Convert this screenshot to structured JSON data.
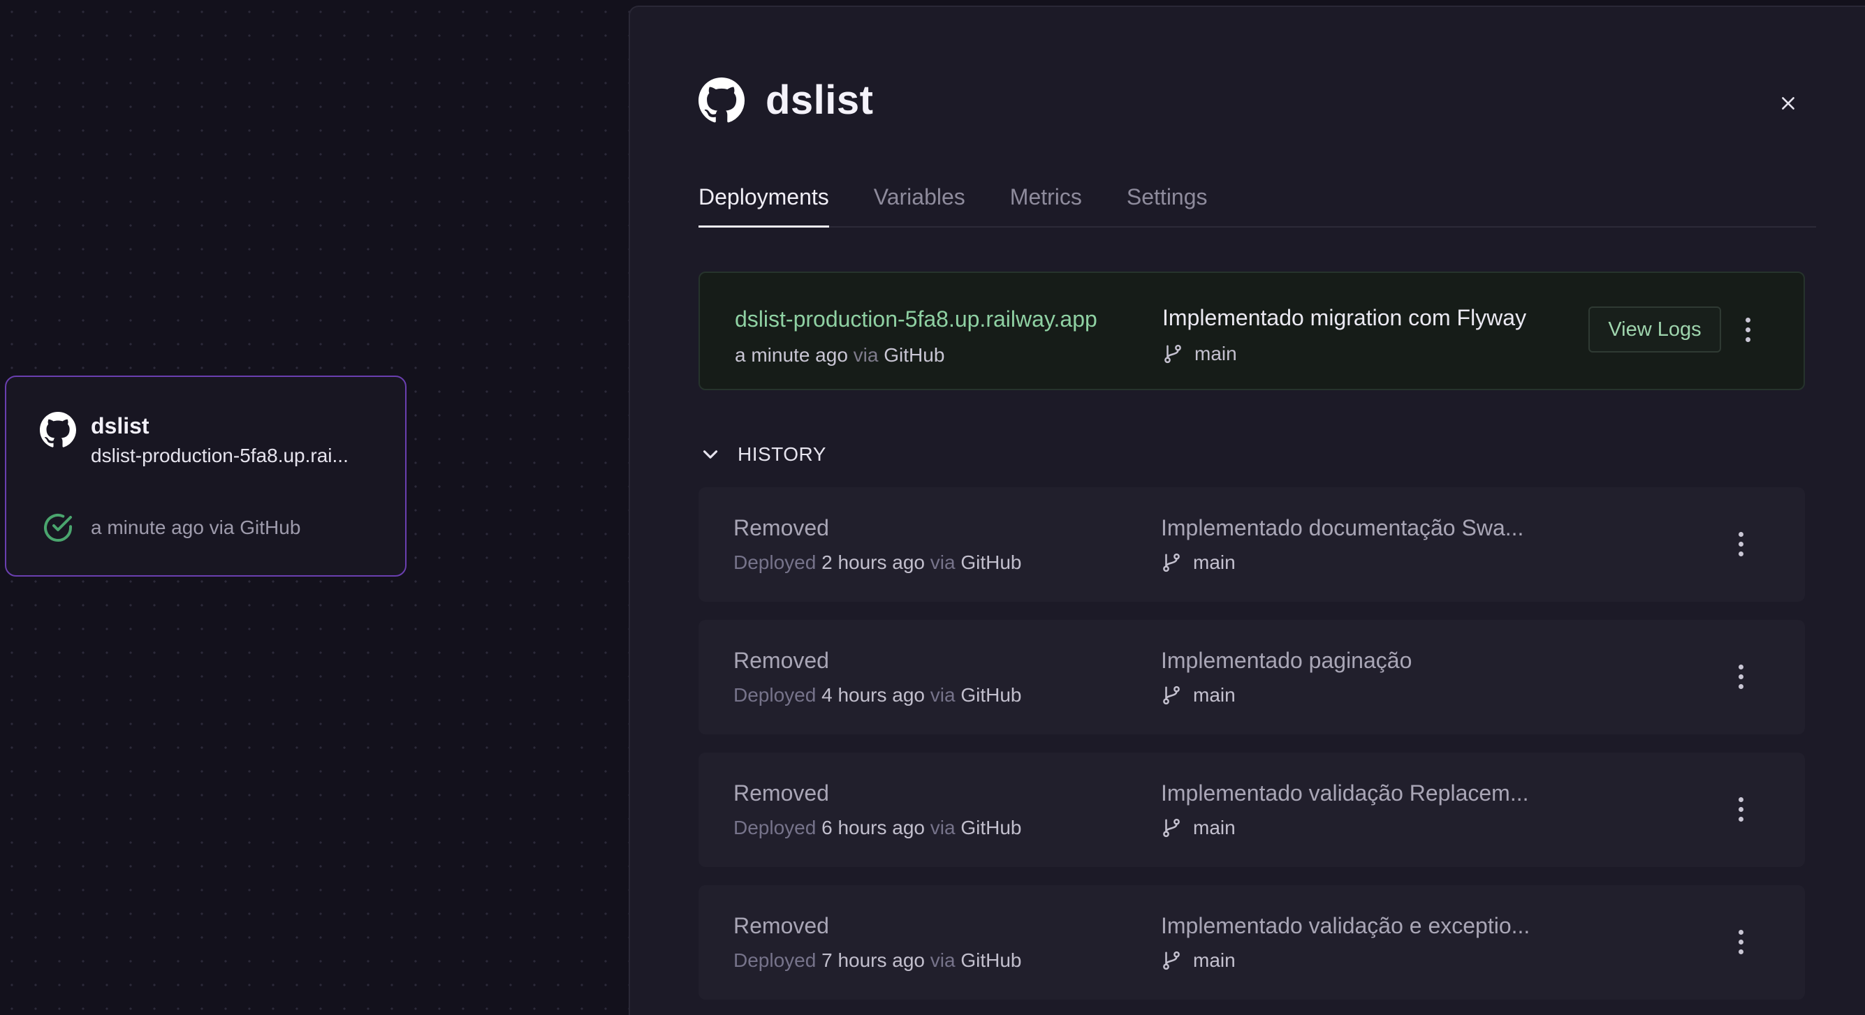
{
  "service_card": {
    "name": "dslist",
    "url": "dslist-production-5fa8.up.rai...",
    "status_text": "a minute ago via GitHub",
    "icon": "github-icon",
    "status_icon": "check-circle-icon",
    "border_color": "#6a3fb0",
    "check_color": "#4aa56e"
  },
  "panel": {
    "title": "dslist",
    "icon": "github-icon",
    "close_icon": "close-icon",
    "tabs": [
      {
        "label": "Deployments",
        "active": true
      },
      {
        "label": "Variables",
        "active": false
      },
      {
        "label": "Metrics",
        "active": false
      },
      {
        "label": "Settings",
        "active": false
      }
    ]
  },
  "active_deployment": {
    "domain": "dslist-production-5fa8.up.railway.app",
    "time": "a minute ago",
    "via": "via",
    "source": "GitHub",
    "commit_message": "Implementado migration com Flyway",
    "branch": "main",
    "view_logs_label": "View Logs",
    "accent_color": "#8fd1a3"
  },
  "history": {
    "label": "HISTORY",
    "items": [
      {
        "status": "Removed",
        "deployed_prefix": "Deployed",
        "time": "2 hours ago",
        "via": "via",
        "source": "GitHub",
        "commit_message": "Implementado documentação Swa...",
        "branch": "main"
      },
      {
        "status": "Removed",
        "deployed_prefix": "Deployed",
        "time": "4 hours ago",
        "via": "via",
        "source": "GitHub",
        "commit_message": "Implementado paginação",
        "branch": "main"
      },
      {
        "status": "Removed",
        "deployed_prefix": "Deployed",
        "time": "6 hours ago",
        "via": "via",
        "source": "GitHub",
        "commit_message": "Implementado validação Replacem...",
        "branch": "main"
      },
      {
        "status": "Removed",
        "deployed_prefix": "Deployed",
        "time": "7 hours ago",
        "via": "via",
        "source": "GitHub",
        "commit_message": "Implementado validação e exceptio...",
        "branch": "main"
      }
    ]
  }
}
